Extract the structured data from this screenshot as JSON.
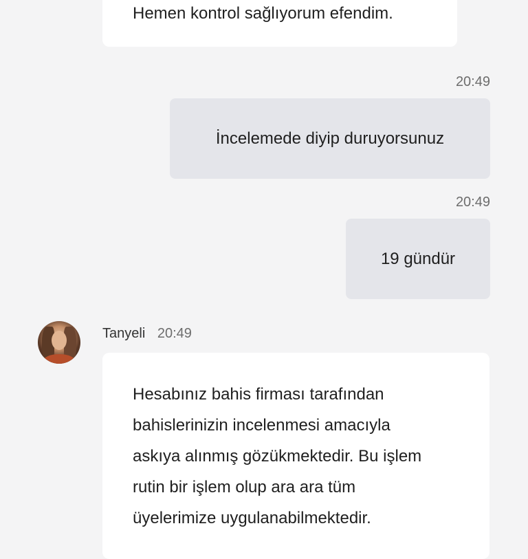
{
  "messages": {
    "agent_top": {
      "text": "Hemen kontrol sağlıyorum efendim."
    },
    "user_1": {
      "time": "20:49",
      "text": "İncelemede diyip duruyorsunuz"
    },
    "user_2": {
      "time": "20:49",
      "text": "19 gündür"
    },
    "agent_reply": {
      "sender": "Tanyeli",
      "time": "20:49",
      "avatar_icon": "agent-avatar",
      "lines": [
        "Hesabınız bahis firması tarafından",
        "bahislerinizin incelenmesi amacıyla",
        "askıya alınmış gözükmektedir. Bu işlem",
        "rutin bir işlem olup ara ara tüm",
        "üyelerimize uygulanabilmektedir."
      ]
    }
  },
  "colors": {
    "background": "#f4f4f5",
    "agent_bubble": "#ffffff",
    "user_bubble": "#e4e5ea",
    "timestamp": "#6d6d6d"
  }
}
